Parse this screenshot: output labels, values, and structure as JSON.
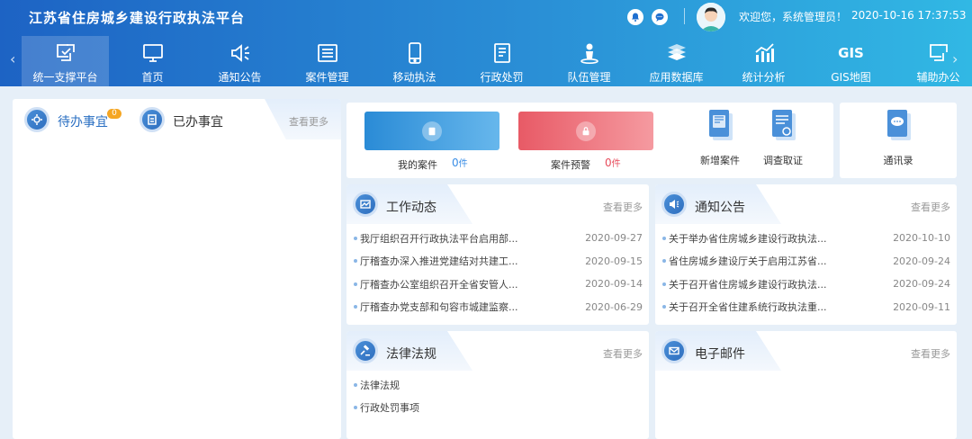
{
  "header": {
    "title": "江苏省住房城乡建设行政执法平台",
    "welcome": "欢迎您，系统管理员！",
    "datetime": "2020-10-16 17:37:53"
  },
  "nav": {
    "items": [
      {
        "label": "统一支撑平台",
        "icon": "platform-icon",
        "active": true
      },
      {
        "label": "首页",
        "icon": "monitor-icon"
      },
      {
        "label": "通知公告",
        "icon": "speaker-icon"
      },
      {
        "label": "案件管理",
        "icon": "case-list-icon"
      },
      {
        "label": "移动执法",
        "icon": "phone-icon"
      },
      {
        "label": "行政处罚",
        "icon": "document-icon"
      },
      {
        "label": "队伍管理",
        "icon": "team-icon"
      },
      {
        "label": "应用数据库",
        "icon": "books-icon"
      },
      {
        "label": "统计分析",
        "icon": "chart-icon"
      },
      {
        "label": "GIS地图",
        "icon": "gis-icon",
        "icon_text": "GIS"
      },
      {
        "label": "辅助办公",
        "icon": "office-icon"
      }
    ]
  },
  "tasks": {
    "pending_label": "待办事宜",
    "pending_count": "0",
    "done_label": "已办事宜",
    "more": "查看更多"
  },
  "stats": {
    "my_cases_label": "我的案件",
    "my_cases_value": "0",
    "case_warning_label": "案件预警",
    "case_warning_value": "0",
    "unit": "件"
  },
  "tools": {
    "new_case": "新增案件",
    "investigation": "调查取证",
    "address_book": "通讯录"
  },
  "work_news": {
    "title": "工作动态",
    "more": "查看更多",
    "items": [
      {
        "title": "我厅组织召开行政执法平台启用部...",
        "date": "2020-09-27"
      },
      {
        "title": "厅稽查办深入推进党建结对共建工...",
        "date": "2020-09-15"
      },
      {
        "title": "厅稽查办公室组织召开全省安管人...",
        "date": "2020-09-14"
      },
      {
        "title": "厅稽查办党支部和句容市城建监察...",
        "date": "2020-06-29"
      }
    ]
  },
  "notices": {
    "title": "通知公告",
    "more": "查看更多",
    "items": [
      {
        "title": "关于举办省住房城乡建设行政执法...",
        "date": "2020-10-10"
      },
      {
        "title": "省住房城乡建设厅关于启用江苏省...",
        "date": "2020-09-24"
      },
      {
        "title": "关于召开省住房城乡建设行政执法...",
        "date": "2020-09-24"
      },
      {
        "title": "关于召开全省住建系统行政执法重...",
        "date": "2020-09-11"
      }
    ]
  },
  "laws": {
    "title": "法律法规",
    "more": "查看更多",
    "items": [
      "法律法规",
      "行政处罚事项"
    ]
  },
  "email": {
    "title": "电子邮件",
    "more": "查看更多"
  }
}
